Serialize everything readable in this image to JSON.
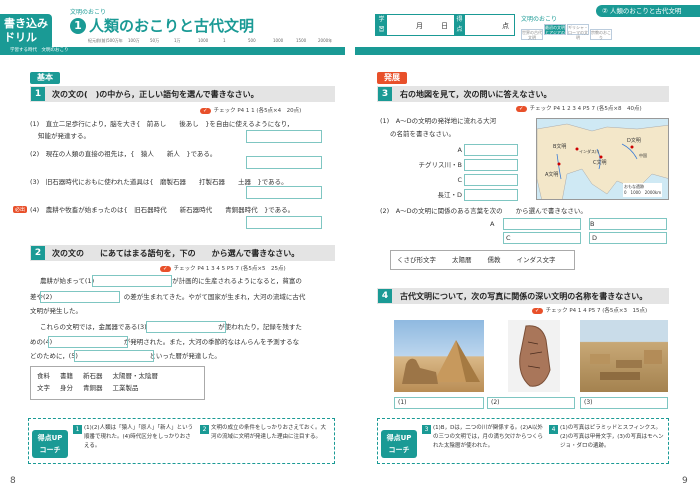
{
  "header": {
    "drill_label_1": "書き込み",
    "drill_label_2": "ドリル",
    "unit_small": "文明のおこり",
    "unit_number": "1",
    "unit_title": "人類のおこりと古代文明",
    "date_label_1": "学習日",
    "date_month": "月",
    "date_day": "日",
    "score_label": "得点",
    "score_unit": "点",
    "right_tag": "② 人類のおこりと古代文明",
    "right_unit": "文明のおこり",
    "side_tabs": [
      "世界の古代文明",
      "最初の文明とアジアの文明",
      "ギリシャ・ローマの文明",
      "宗教のおこり"
    ],
    "time_labels": [
      "紀元前(前)500万年",
      "100万",
      "50万",
      "1万",
      "1000",
      "1",
      "500",
      "1000",
      "1500",
      "2000年"
    ],
    "strip_label": "学習する時代　文明のおこり"
  },
  "left": {
    "basic_tag": "基本",
    "q1": {
      "number": "1",
      "prompt": "次の文の(　)の中から，正しい語句を選んで書きなさい。",
      "check": "チェック P4 1 1 (各5点×4　20点)",
      "lines": [
        "(1)　直立二足歩行により，脳を大き{　前あし　　後あし　}を自由に使えるようになり，",
        "知能が発達する。",
        "(2)　現在の人類の直接の祖先は，{　猿人　　新人　}である。",
        "(3)　旧石器時代におもに使われた道具は{　磨製石器　　打製石器　　土器　}である。",
        "(4)　農耕や牧畜が始まったのは{　旧石器時代　　新石器時代　　青銅器時代　}である。"
      ],
      "important_label": "必出"
    },
    "q2": {
      "number": "2",
      "prompt": "次の文の　　にあてはまる語句を，下の　　から選んで書きなさい。",
      "check": "チェック P4 1 3 4 5 P5 7 (各5点×5　25点)",
      "lines": [
        "農耕が始まって(1)　　　　　　　　　　　　が計画的に生産されるようになると，貧富の",
        "差や(2)　　　　　　　　　　　の差が生まれてきた。やがて国家が生まれ，大河の流域に古代",
        "文明が発生した。",
        "これらの文明では，金属器である(3)　　　　　　　　　　　が使われたり，記録を残すた",
        "めの(4)　　　　　　　　　　　が発明された。また，大河の季節的なはんらんを予測するな",
        "どのために，(5)　　　　　　　　　　　といった暦が発達した。"
      ],
      "words_row1": [
        "食料",
        "書籍",
        "新石器",
        "太陽暦・太陰暦"
      ],
      "words_row2": [
        "文字",
        "身分",
        "青銅器",
        "工業製品"
      ]
    },
    "coach": {
      "badge_1": "得点UP",
      "badge_2": "コーチ",
      "item1_num": "1",
      "item1": "(1)(2)人類は「猿人」「原人」「新人」という順番で現れた。(4)時代区分をしっかりおさえる。",
      "item2_num": "2",
      "item2": "文明の成立の条件をしっかりおさえておく。大河の流域に文明が発達した理由に注目する。"
    },
    "page_number": "8"
  },
  "right": {
    "advanced_tag": "発展",
    "q3": {
      "number": "3",
      "prompt": "右の地図を見て，次の問いに答えなさい。",
      "check": "チェック P4 1 2 3 4 P5 7 (各5点×8　40点)",
      "sub1": "(1)　A～Dの文明の発祥地に流れる大河",
      "sub1b": "の名前を書きなさい。",
      "rivers": [
        "A",
        "チグリス川・B",
        "C",
        "長江・D"
      ],
      "sub2": "(2)　A～Dの文明に関係のある言葉を次の　　から選んで書きなさい。",
      "answers": [
        "A",
        "B",
        "C",
        "D"
      ],
      "words": [
        "くさび形文字",
        "太陽暦",
        "儒教",
        "インダス文字"
      ],
      "map_labels": [
        "D文明",
        "B文明",
        "C文明",
        "A文明",
        "インダス川",
        "中国"
      ],
      "map_legend": [
        "おもな遺跡",
        "0　1000　2000km"
      ]
    },
    "q4": {
      "number": "4",
      "prompt": "古代文明について，次の写真に関係の深い文明の名称を書きなさい。",
      "check": "チェック P4 1 4 P5 7 (各5点×3　15点)",
      "captions": [
        "(1)",
        "(2)",
        "(3)"
      ]
    },
    "coach": {
      "badge_1": "得点UP",
      "badge_2": "コーチ",
      "item3_num": "3",
      "item3": "(1)B，Dは，二つの川が関係する。(2)A以外の三つの文明では，月の満ち欠けからつくられた太陰暦が使われた。",
      "item4_num": "4",
      "item4": "(1)の写真はピラミッドとスフィンクス。(2)の写真は甲骨文字，(3)の写真はモヘンジョ・ダロの遺跡。"
    },
    "page_number": "9"
  },
  "colors": {
    "teal": "#1a9a95",
    "orange": "#e8502a",
    "basic": "#1a9a95",
    "advanced": "#e8502a"
  }
}
